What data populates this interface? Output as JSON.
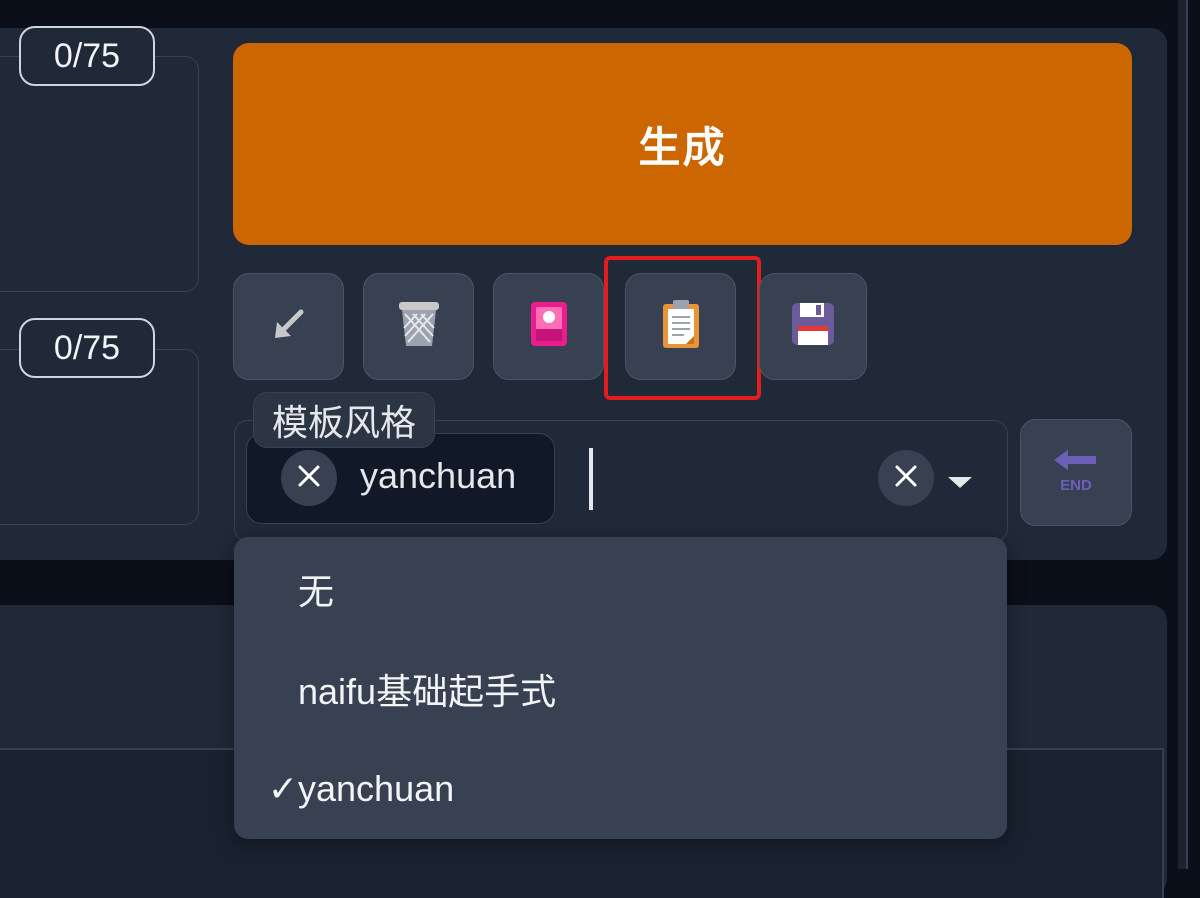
{
  "prompt_counters": [
    "0/75",
    "0/75"
  ],
  "generate_button": {
    "label": "生成",
    "color": "#cc6600"
  },
  "toolbar": {
    "buttons": [
      {
        "name": "read-generation-parameters-button",
        "icon": "arrow-down-left-icon"
      },
      {
        "name": "clear-prompt-button",
        "icon": "trash-icon"
      },
      {
        "name": "show-extra-networks-button",
        "icon": "image-card-icon"
      },
      {
        "name": "apply-styles-button",
        "icon": "clipboard-icon",
        "highlighted": true
      },
      {
        "name": "save-style-button",
        "icon": "floppy-disk-icon"
      }
    ],
    "highlight_color": "#e11d1d"
  },
  "styles": {
    "label": "模板风格",
    "selected": [
      "yanchuan"
    ],
    "input_value": "",
    "options": [
      {
        "label": "无",
        "checked": false
      },
      {
        "label": "naifu基础起手式",
        "checked": false
      },
      {
        "label": "yanchuan",
        "checked": true
      }
    ],
    "check_mark": "✓"
  },
  "end_button": {
    "icon": "end-arrow-icon",
    "text": "END"
  }
}
